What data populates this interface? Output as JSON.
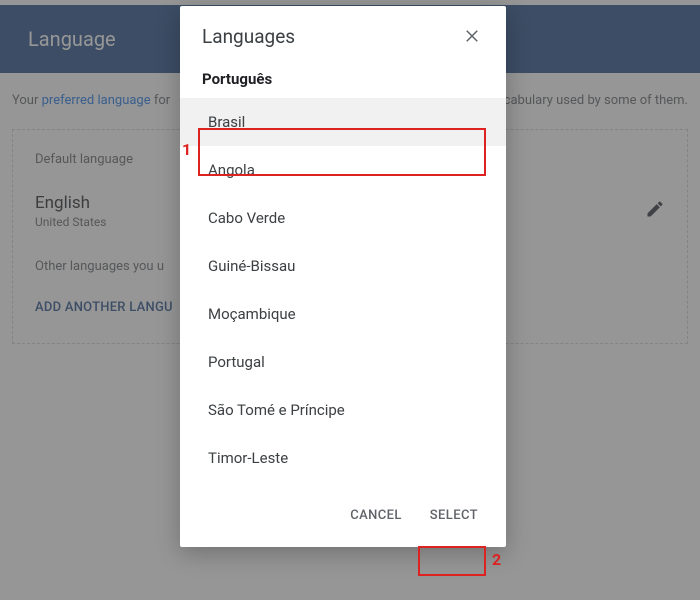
{
  "page": {
    "header": "Language",
    "intro_prefix": "Your ",
    "intro_link": "preferred language",
    "intro_mid": " for",
    "intro_tail": "he spelling or vocabulary used by some of them.",
    "card": {
      "default_label": "Default language",
      "lang_name": "English",
      "lang_region": "United States",
      "other_label": "Other languages you u",
      "add_link": "ADD ANOTHER LANGU"
    }
  },
  "dialog": {
    "title": "Languages",
    "subtitle": "Português",
    "options": [
      "Brasil",
      "Angola",
      "Cabo Verde",
      "Guiné-Bissau",
      "Moçambique",
      "Portugal",
      "São Tomé e Príncipe",
      "Timor-Leste"
    ],
    "selected_index": 0,
    "cancel_label": "CANCEL",
    "select_label": "SELECT"
  },
  "annotations": {
    "num1": "1",
    "num2": "2"
  }
}
